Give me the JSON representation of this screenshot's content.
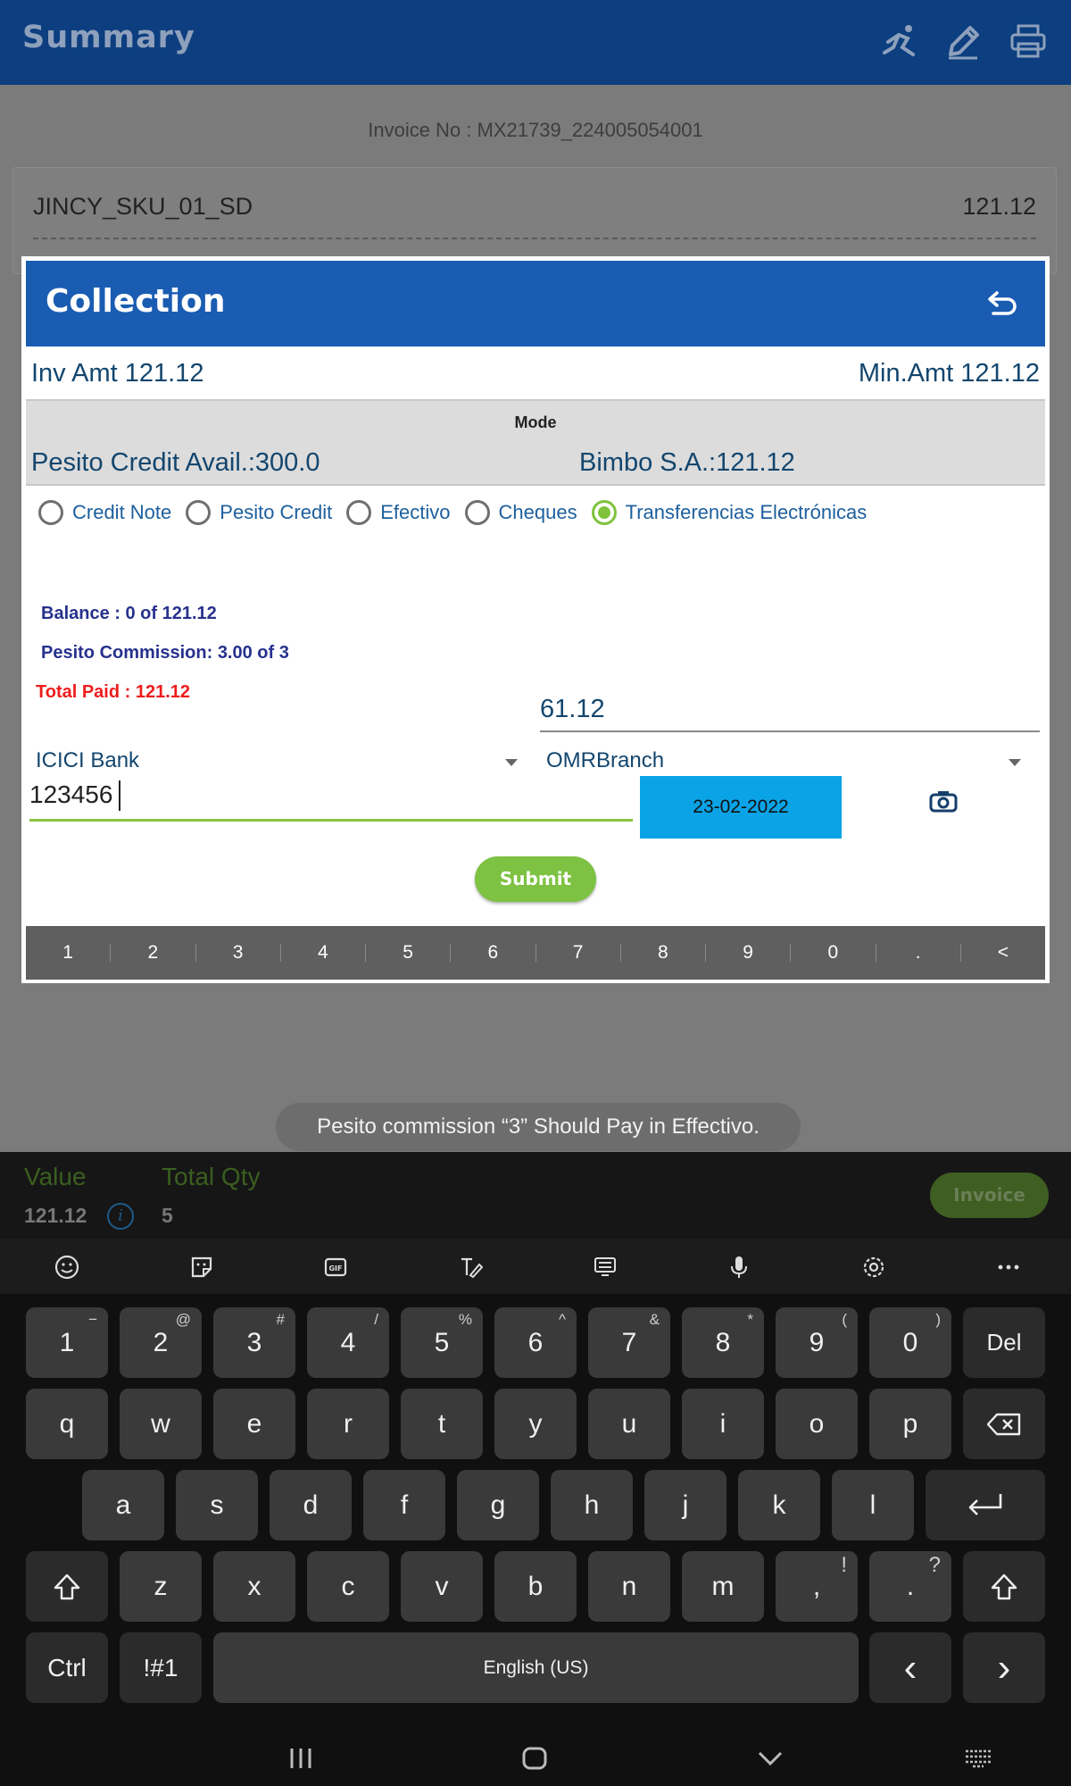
{
  "app": {
    "title": "Summary",
    "invoice_no": "Invoice No : MX21739_224005054001",
    "item": {
      "name": "JINCY_SKU_01_SD",
      "amount": "121.12"
    }
  },
  "modal": {
    "title": "Collection",
    "inv_amt": "Inv Amt  121.12",
    "min_amt": "Min.Amt  121.12",
    "mode_label": "Mode",
    "pesito_credit_avail": "Pesito Credit Avail.:300.0",
    "bimbo": "Bimbo S.A.:121.12",
    "payment_modes": [
      {
        "label": "Credit Note",
        "selected": false
      },
      {
        "label": "Pesito Credit",
        "selected": false
      },
      {
        "label": "Efectivo",
        "selected": false
      },
      {
        "label": "Cheques",
        "selected": false
      },
      {
        "label": "Transferencias Electrónicas",
        "selected": true
      }
    ],
    "balance": "Balance : 0 of 121.12",
    "commission": "Pesito Commission: 3.00 of 3",
    "total_paid": "Total Paid : 121.12",
    "amount_value": "61.12",
    "bank": "ICICI Bank",
    "branch": "OMRBranch",
    "reference_value": "123456",
    "date": "23-02-2022",
    "submit_label": "Submit",
    "numpad": [
      "1",
      "2",
      "3",
      "4",
      "5",
      "6",
      "7",
      "8",
      "9",
      "0",
      ".",
      "<"
    ]
  },
  "toast": "Pesito commission “3” Should Pay in Effectivo.",
  "summary_bar": {
    "value_label": "Value",
    "value": "121.12",
    "qty_label": "Total Qty",
    "qty": "5",
    "invoice_label": "Invoice"
  },
  "keyboard": {
    "row1": [
      {
        "k": "1",
        "s": "−"
      },
      {
        "k": "2",
        "s": "@"
      },
      {
        "k": "3",
        "s": "#"
      },
      {
        "k": "4",
        "s": "/"
      },
      {
        "k": "5",
        "s": "%"
      },
      {
        "k": "6",
        "s": "^"
      },
      {
        "k": "7",
        "s": "&"
      },
      {
        "k": "8",
        "s": "*"
      },
      {
        "k": "9",
        "s": "("
      },
      {
        "k": "0",
        "s": ")"
      }
    ],
    "del": "Del",
    "row2": [
      "q",
      "w",
      "e",
      "r",
      "t",
      "y",
      "u",
      "i",
      "o",
      "p"
    ],
    "row3": [
      "a",
      "s",
      "d",
      "f",
      "g",
      "h",
      "j",
      "k",
      "l"
    ],
    "row4": [
      "z",
      "x",
      "c",
      "v",
      "b",
      "n",
      "m"
    ],
    "comma": ",",
    "comma_sup": "!",
    "period": ".",
    "period_sup": "?",
    "ctrl": "Ctrl",
    "sym": "!#1",
    "space": "English (US)",
    "left": "‹",
    "right": "›"
  },
  "colors": {
    "app_bar": "#0c3e80",
    "modal_header": "#1a5cb2",
    "accent_green": "#7dc242",
    "date_button": "#0aa3e6",
    "total_paid": "#ee1c1c"
  }
}
